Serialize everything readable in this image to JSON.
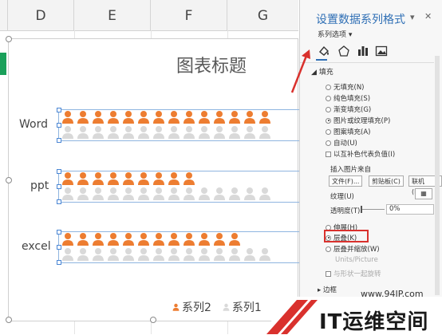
{
  "sheet": {
    "columns": [
      "D",
      "E",
      "F",
      "G"
    ]
  },
  "chart": {
    "title": "图表标题",
    "legend": [
      {
        "label": "系列2",
        "color": "#ed7d31"
      },
      {
        "label": "系列1",
        "color": "#d9d9d9"
      }
    ]
  },
  "chart_data": {
    "type": "bar",
    "title": "图表标题",
    "categories": [
      "Word",
      "ppt",
      "excel"
    ],
    "series": [
      {
        "name": "系列2",
        "values": [
          14,
          9,
          12
        ]
      },
      {
        "name": "系列1",
        "values": [
          14,
          14,
          14
        ]
      }
    ],
    "colors": {
      "系列2": "#ed7d31",
      "系列1": "#d9d9d9"
    },
    "legend": "bottom"
  },
  "panel": {
    "title": "设置数据系列格式",
    "series_options": "系列选项",
    "section_fill": "填充",
    "fill_options": [
      "无填充(N)",
      "纯色填充(S)",
      "渐变填充(G)",
      "图片或纹理填充(P)",
      "图案填充(A)",
      "自动(U)"
    ],
    "selected_fill": "图片或纹理填充(P)",
    "invert_if_negative": "以互补色代表负值(I)",
    "insert_from": "插入图片来自",
    "btn_file": "文件(F)...",
    "btn_clipboard": "剪贴板(C)",
    "btn_online": "联机(E)...",
    "texture": "纹理(U)",
    "transparency": "透明度(T)",
    "transparency_value": "0%",
    "stretch": "伸展(H)",
    "stack": "层叠(K)",
    "stack_scale": "层叠并缩放(W)",
    "units_picture": "Units/Picture",
    "rotate_with_shape": "与形状一起旋转",
    "border": "边框"
  },
  "watermark": {
    "url": "www.94IP.com",
    "text": "IT运维空间"
  }
}
